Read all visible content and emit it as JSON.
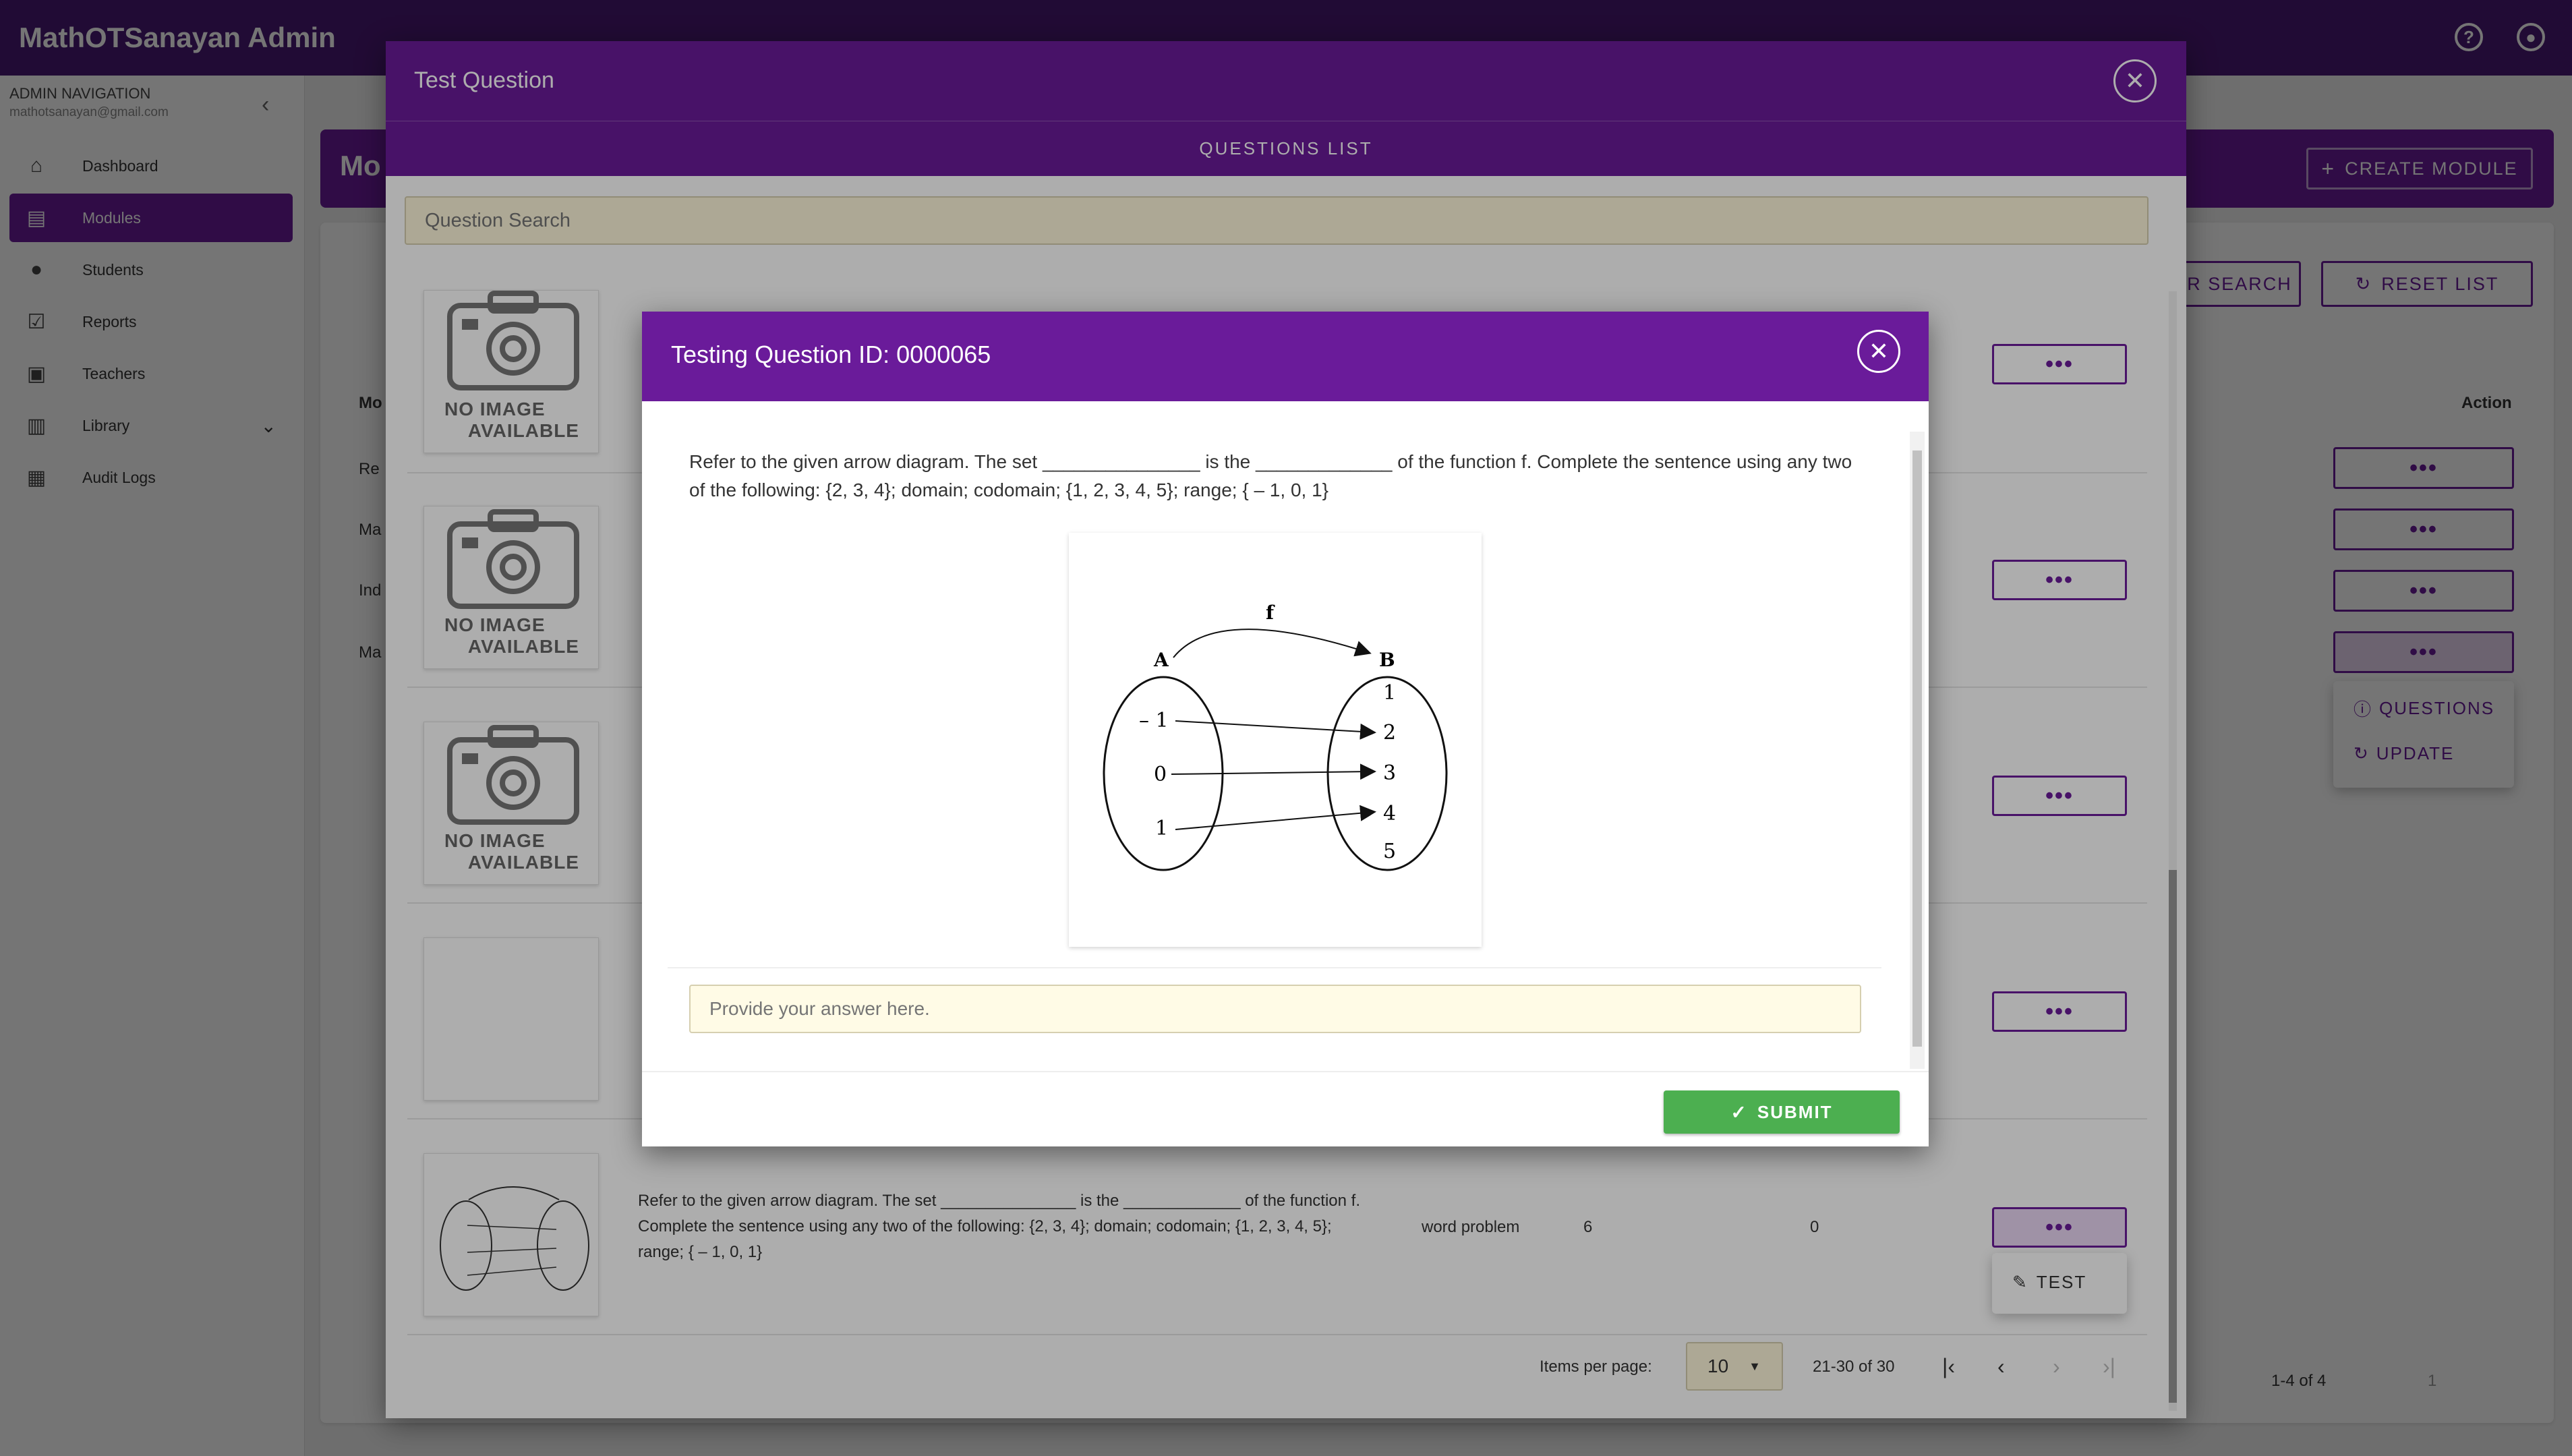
{
  "app": {
    "title": "MathOTSanayan Admin"
  },
  "sidebar": {
    "heading": "ADMIN NAVIGATION",
    "email": "mathotsanayan@gmail.com",
    "items": [
      {
        "label": "Dashboard",
        "icon": "home-icon"
      },
      {
        "label": "Modules",
        "icon": "modules-icon"
      },
      {
        "label": "Students",
        "icon": "person-icon"
      },
      {
        "label": "Reports",
        "icon": "check-icon"
      },
      {
        "label": "Teachers",
        "icon": "teacher-icon"
      },
      {
        "label": "Library",
        "icon": "library-icon"
      },
      {
        "label": "Audit Logs",
        "icon": "clipboard-icon"
      }
    ]
  },
  "modules_page": {
    "title_fragment": "Mo",
    "create_label": "CREATE MODULE",
    "search_label_fragment": "R SEARCH",
    "reset_label": "RESET LIST",
    "col_mod": "Mo",
    "col_action": "Action",
    "rows": [
      "Re",
      "Ma",
      "Ind",
      "Ma"
    ],
    "dots": "•••",
    "menu": {
      "questions": "QUESTIONS",
      "update": "UPDATE"
    },
    "pagination": "1-4 of 4",
    "page_num": "1"
  },
  "question_dialog": {
    "title": "Test Question",
    "tab": "QUESTIONS LIST",
    "search_placeholder": "Question Search",
    "no_image_1": "NO IMAGE",
    "no_image_2": "AVAILABLE",
    "last_row": {
      "text": "Refer to the given arrow diagram. The set _______________ is the _____________ of the function f. Complete the sentence using any two of the following: {2, 3, 4}; domain; codomain; {1, 2, 3, 4, 5}; range; { – 1, 0, 1}",
      "type": "word problem",
      "col_a": "6",
      "col_b": "0"
    },
    "test_menu": "TEST",
    "pagination": {
      "items_per_page_label": "Items per page:",
      "items_per_page": "10",
      "range": "21-30 of 30"
    }
  },
  "test_dialog": {
    "title": "Testing Question ID: 0000065",
    "question": "Refer to the given arrow diagram. The set _______________ is the _____________ of the function f. Complete the sentence using any two of the following: {2, 3, 4}; domain; codomain; {1, 2, 3, 4, 5}; range; { – 1, 0, 1}",
    "answer_placeholder": "Provide your answer here.",
    "submit_label": "SUBMIT",
    "diagram": {
      "function_label": "f",
      "set_a_label": "A",
      "set_b_label": "B",
      "domain": [
        "– 1",
        "0",
        "1"
      ],
      "codomain": [
        "1",
        "2",
        "3",
        "4",
        "5"
      ]
    }
  }
}
